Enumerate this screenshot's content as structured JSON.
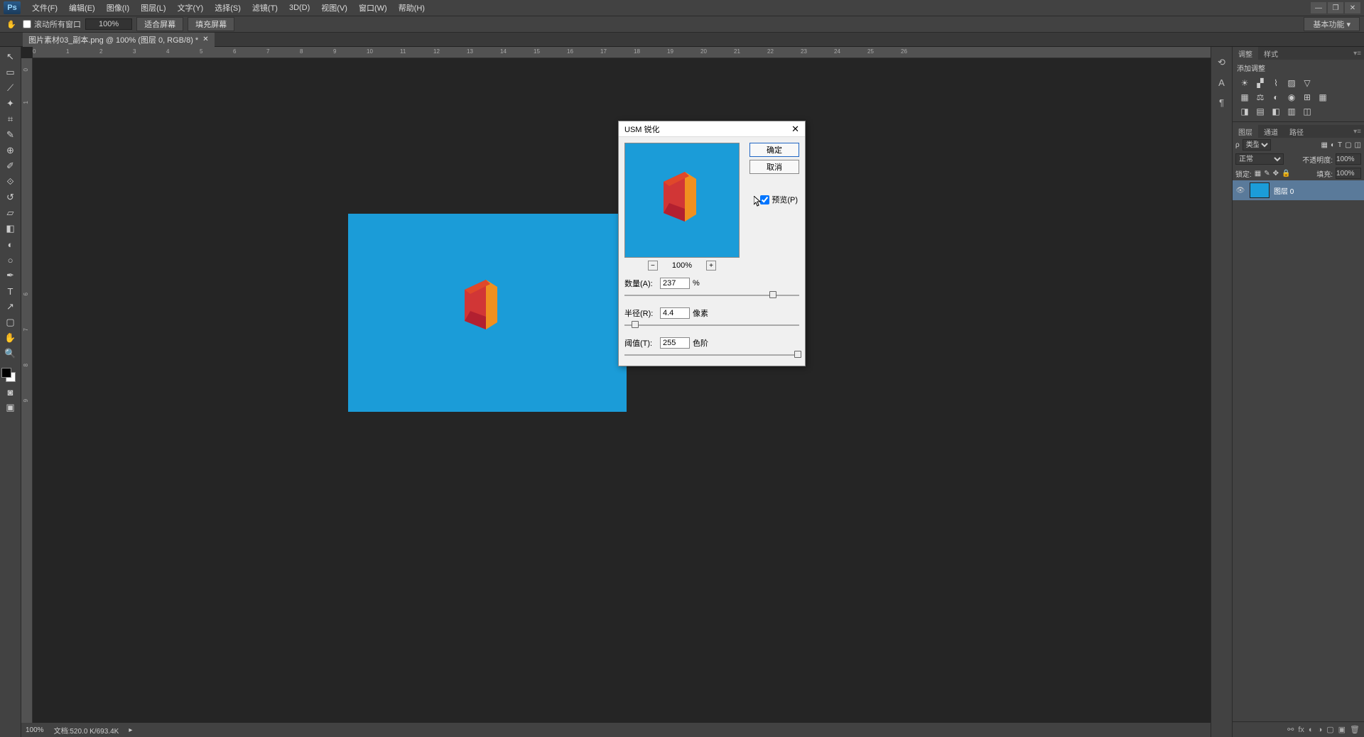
{
  "menubar": {
    "items": [
      "文件(F)",
      "编辑(E)",
      "图像(I)",
      "图层(L)",
      "文字(Y)",
      "选择(S)",
      "滤镜(T)",
      "3D(D)",
      "视图(V)",
      "窗口(W)",
      "帮助(H)"
    ]
  },
  "options": {
    "scroll_all": "滚动所有窗口",
    "zoom_pct": "100%",
    "fit_screen": "适合屏幕",
    "fill_screen": "填充屏幕",
    "essentials": "基本功能"
  },
  "doc": {
    "tab_title": "图片素材03_副本.png @ 100% (图层 0, RGB/8) *"
  },
  "ruler_h_ticks": [
    "0",
    "1",
    "2",
    "3",
    "4",
    "5",
    "6",
    "7",
    "8",
    "9",
    "10",
    "11",
    "12",
    "13",
    "14",
    "15",
    "16",
    "17",
    "18",
    "19",
    "20",
    "21",
    "22",
    "23",
    "24",
    "25",
    "26"
  ],
  "ruler_v_ticks": [
    "0",
    "1",
    "6",
    "7",
    "8",
    "9"
  ],
  "adjustments": {
    "tab1": "调整",
    "tab2": "样式",
    "label": "添加调整"
  },
  "layers": {
    "tab1": "图层",
    "tab2": "通道",
    "tab3": "路径",
    "kind_label": "类型",
    "blend_mode": "正常",
    "opacity_label": "不透明度:",
    "opacity_val": "100%",
    "lock_label": "锁定:",
    "fill_label": "填充:",
    "fill_val": "100%",
    "layer0_name": "图层 0"
  },
  "dialog": {
    "title": "USM 锐化",
    "ok": "确定",
    "cancel": "取消",
    "preview_label": "预览(P)",
    "zoom_pct": "100%",
    "amount_label": "数量(A):",
    "amount_val": "237",
    "amount_unit": "%",
    "radius_label": "半径(R):",
    "radius_val": "4.4",
    "radius_unit": "像素",
    "threshold_label": "阈值(T):",
    "threshold_val": "255",
    "threshold_unit": "色阶"
  },
  "status": {
    "zoom": "100%",
    "doc_info": "文档:520.0 K/693.4K"
  }
}
